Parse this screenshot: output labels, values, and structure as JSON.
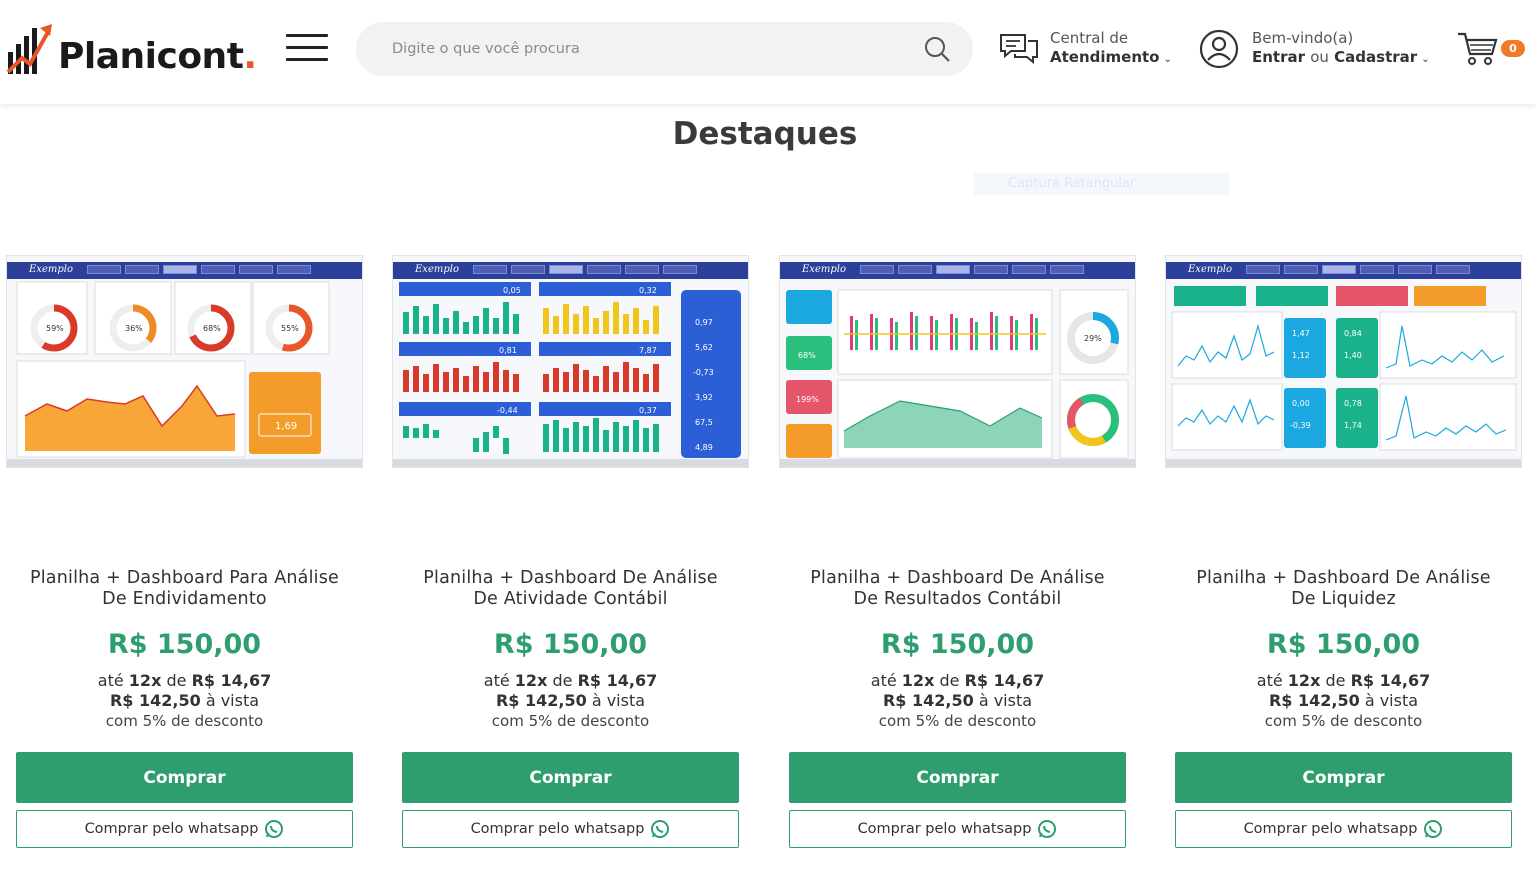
{
  "header": {
    "logo_text": "Planicont",
    "logo_dot": ".",
    "search_placeholder": "Digite o que você procura",
    "service_line1": "Central de",
    "service_line2": "Atendimento",
    "account_line1": "Bem-vindo(a)",
    "account_enter": "Entrar",
    "account_or": "ou",
    "account_register": "Cadastrar",
    "cart_count": "0"
  },
  "section": {
    "title": "Destaques",
    "ghost_text": "Captura Retangular"
  },
  "products": [
    {
      "name_line1": "Planilha + Dashboard Para Análise",
      "name_line2": "De Endividamento",
      "price": "R$ 150,00",
      "inst_prefix": "até",
      "inst_n": "12x",
      "inst_de": "de",
      "inst_value": "R$ 14,67",
      "cash_value": "R$ 142,50",
      "cash_suffix": "à vista",
      "discount": "com 5% de desconto",
      "buy_label": "Comprar",
      "wa_label": "Comprar pelo whatsapp",
      "thumb_label": "Exemplo"
    },
    {
      "name_line1": "Planilha + Dashboard De Análise",
      "name_line2": "De Atividade Contábil",
      "price": "R$ 150,00",
      "inst_prefix": "até",
      "inst_n": "12x",
      "inst_de": "de",
      "inst_value": "R$ 14,67",
      "cash_value": "R$ 142,50",
      "cash_suffix": "à vista",
      "discount": "com 5% de desconto",
      "buy_label": "Comprar",
      "wa_label": "Comprar pelo whatsapp",
      "thumb_label": "Exemplo"
    },
    {
      "name_line1": "Planilha + Dashboard De Análise",
      "name_line2": "De Resultados Contábil",
      "price": "R$ 150,00",
      "inst_prefix": "até",
      "inst_n": "12x",
      "inst_de": "de",
      "inst_value": "R$ 14,67",
      "cash_value": "R$ 142,50",
      "cash_suffix": "à vista",
      "discount": "com 5% de desconto",
      "buy_label": "Comprar",
      "wa_label": "Comprar pelo whatsapp",
      "thumb_label": "Exemplo"
    },
    {
      "name_line1": "Planilha + Dashboard De Análise",
      "name_line2": "De Liquidez",
      "price": "R$ 150,00",
      "inst_prefix": "até",
      "inst_n": "12x",
      "inst_de": "de",
      "inst_value": "R$ 14,67",
      "cash_value": "R$ 142,50",
      "cash_suffix": "à vista",
      "discount": "com 5% de desconto",
      "buy_label": "Comprar",
      "wa_label": "Comprar pelo whatsapp",
      "thumb_label": "Exemplo"
    }
  ],
  "thumb_values": {
    "p1": [
      "59%",
      "36%",
      "68%",
      "55%",
      "1,69"
    ],
    "p2": [
      "0,05",
      "0,32",
      "0,81",
      "7,87",
      "-0,44",
      "0,37",
      "0,97",
      "5,62",
      "-0,73",
      "3,92",
      "67,5",
      "4,89"
    ],
    "p3": [
      "68%",
      "199%",
      "29%"
    ],
    "p4": [
      "1,47",
      "1,12",
      "0,84",
      "1,40",
      "0,00",
      "-0,39",
      "0,78",
      "1,74"
    ]
  },
  "colors": {
    "brand_green": "#2e9e6e",
    "accent_orange": "#f07a2a",
    "dash_blue": "#2c3f9a"
  },
  "icons": [
    "menu-icon",
    "search-icon",
    "chat-icon",
    "user-icon",
    "cart-icon",
    "whatsapp-icon"
  ]
}
